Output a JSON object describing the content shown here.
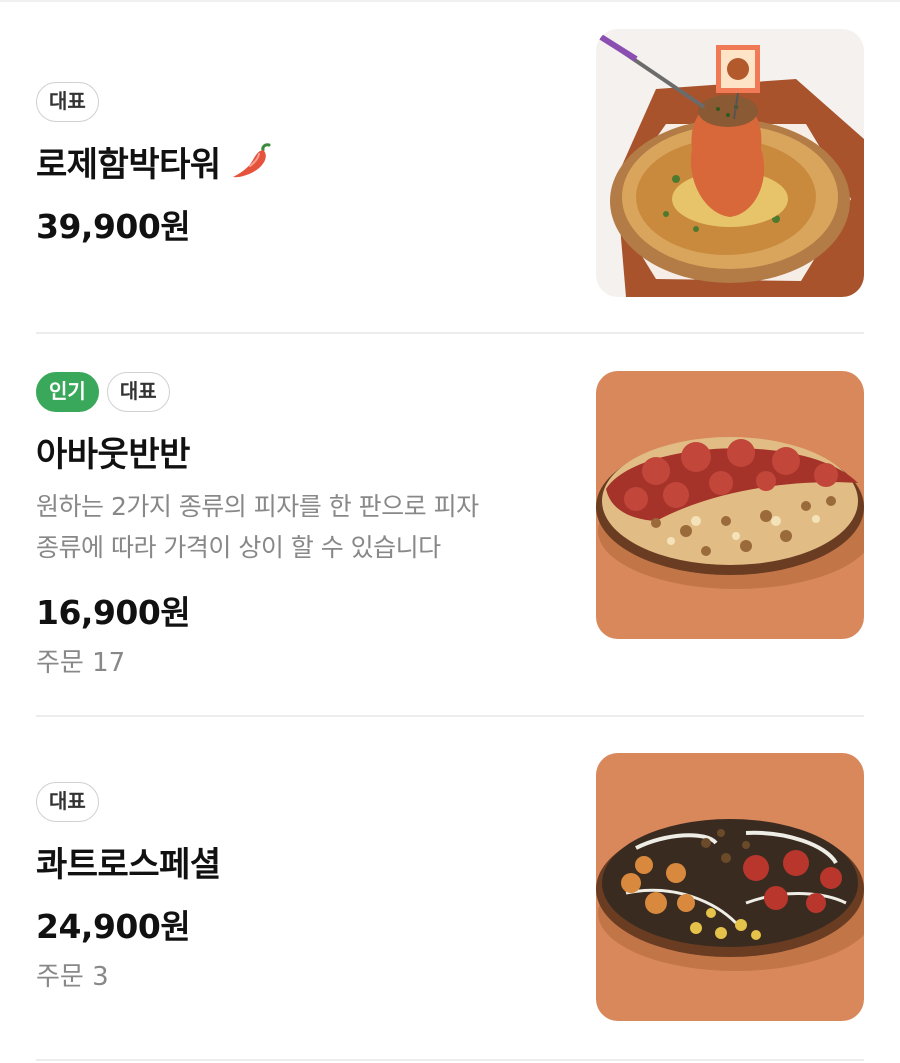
{
  "menu": {
    "items": [
      {
        "tags": [
          {
            "label": "대표",
            "style": "outline"
          }
        ],
        "name": "로제함박타워",
        "spicy_icon": "chili-pepper-icon",
        "price": "39,900원"
      },
      {
        "tags": [
          {
            "label": "인기",
            "style": "green"
          },
          {
            "label": "대표",
            "style": "outline"
          }
        ],
        "name": "아바웃반반",
        "description_line1": "원하는 2가지 종류의 피자를 한 판으로 피자",
        "description_line2": "종류에 따라 가격이 상이 할 수 있습니다",
        "price": "16,900원",
        "orders": "주문 17"
      },
      {
        "tags": [
          {
            "label": "대표",
            "style": "outline"
          }
        ],
        "name": "콰트로스페셜",
        "price": "24,900원",
        "orders": "주문 3"
      }
    ]
  },
  "colors": {
    "popular_tag": "#3aa85a",
    "thumb_background": "#d9885c",
    "divider": "#ececec"
  }
}
